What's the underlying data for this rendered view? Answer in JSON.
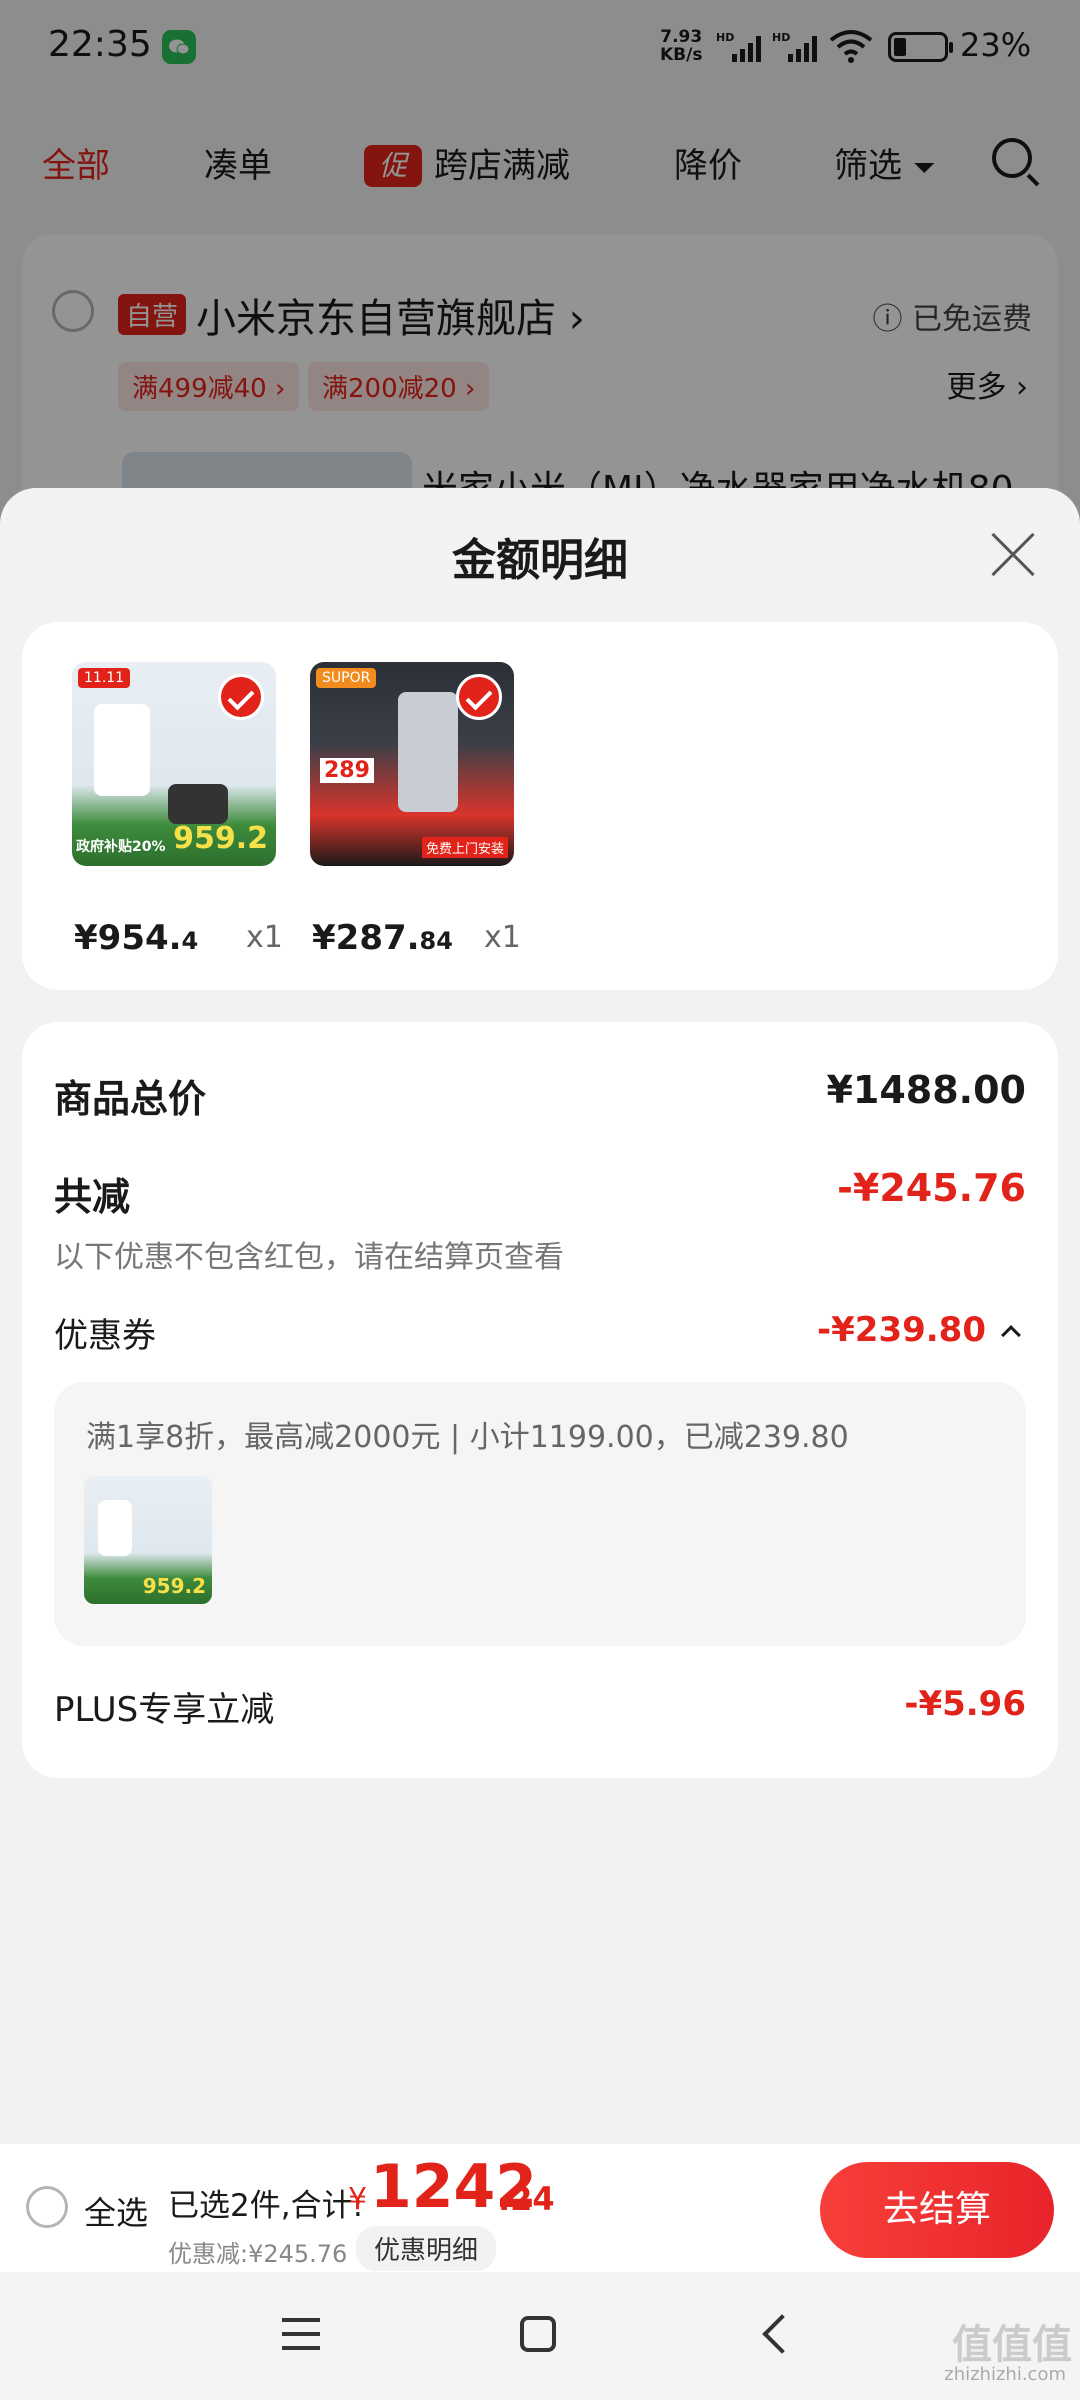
{
  "status_bar": {
    "time": "22:35",
    "net_speed_value": "7.93",
    "net_speed_unit": "KB/s",
    "signal_label_1": "HD",
    "signal_label_2": "HD",
    "battery_percent": "23%"
  },
  "filter_bar": {
    "items": [
      "全部",
      "凑单",
      "跨店满减",
      "降价",
      "筛选"
    ],
    "promo_tag": "促",
    "active_index": 0
  },
  "store": {
    "self_operated_tag": "自营",
    "name": "小米京东自营旗舰店 ›",
    "shipping": "ⓘ 已免运费",
    "coupons": [
      "满499减40 ›",
      "满200减20 ›"
    ],
    "more_label": "更多 ›",
    "product_title_preview": "米家小米（MI）净水器家用净水机80"
  },
  "sheet": {
    "title": "金额明细",
    "products": [
      {
        "price_int": "¥954.",
        "price_dec": "4",
        "qty": "x1",
        "thumb_price": "959.2",
        "thumb_text": "政府补贴20%",
        "thumb_tag": "11.11"
      },
      {
        "price_int": "¥287.",
        "price_dec": "84",
        "qty": "x1",
        "thumb_price": "289",
        "thumb_text": "免费上门安装",
        "thumb_tag": "SUPOR"
      }
    ],
    "summary": {
      "total_label": "商品总价",
      "total_value": "¥1488.00",
      "reduced_label": "共减",
      "reduced_value": "-¥245.76",
      "reduced_note": "以下优惠不包含红包，请在结算页查看",
      "coupon_label": "优惠券",
      "coupon_value": "-¥239.80",
      "coupon_detail": "满1享8折，最高减2000元 | 小计1199.00，已减239.80",
      "coupon_thumb_price": "959.2",
      "plus_label": "PLUS专享立减",
      "plus_value": "-¥5.96"
    }
  },
  "checkout": {
    "select_all": "全选",
    "selected_summary": "已选2件,合计:",
    "currency": "¥",
    "total_int": "1242",
    "total_dec": ".24",
    "discount_line": "优惠减:¥245.76",
    "discount_button": "优惠明细",
    "checkout_button": "去结算"
  },
  "watermark": {
    "main": "值值值",
    "sub": "zhizhizhi.com"
  },
  "colors": {
    "accent_red": "#e2231a",
    "sheet_bg": "#f2f2f2"
  }
}
